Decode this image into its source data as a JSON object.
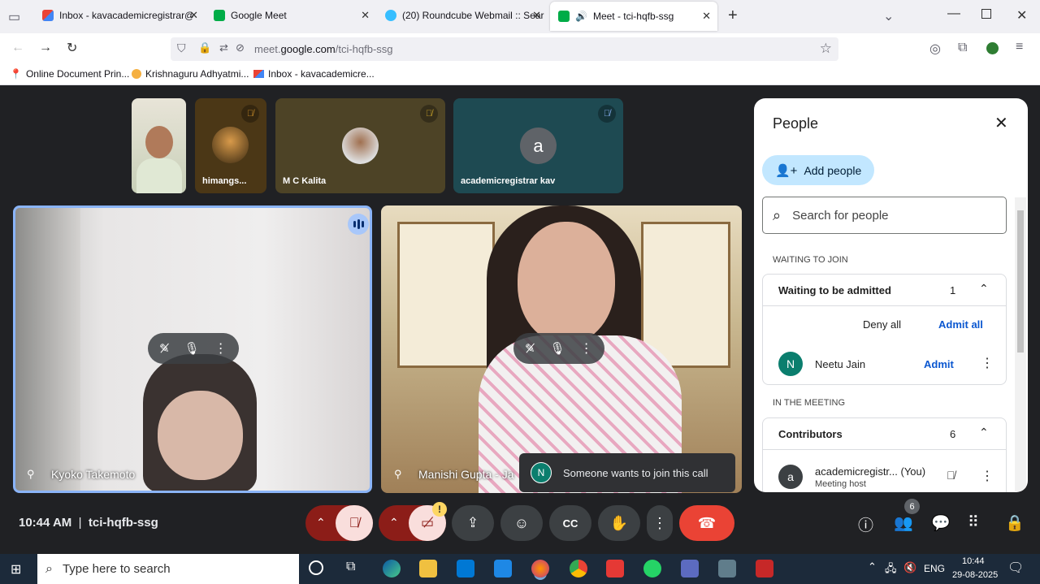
{
  "tabs": [
    {
      "title": "Inbox - kavacademicregistrar@",
      "favicon": "gmail-icon"
    },
    {
      "title": "Google Meet",
      "favicon": "meet-icon"
    },
    {
      "title": "(20) Roundcube Webmail :: Sear",
      "favicon": "roundcube-icon"
    },
    {
      "title": "Meet - tci-hqfb-ssg",
      "favicon": "meet-icon",
      "active": true
    }
  ],
  "url": {
    "prefix": "meet.",
    "domain": "google.com",
    "path": "/tci-hqfb-ssg"
  },
  "bookmarks": [
    {
      "label": "Online Document Prin..."
    },
    {
      "label": "Krishnaguru Adhyatmi..."
    },
    {
      "label": "Inbox - kavacademicre..."
    }
  ],
  "participants_top": [
    {
      "name": "",
      "muted": false
    },
    {
      "name": "himangs...",
      "muted": true
    },
    {
      "name": "M C Kalita",
      "muted": true
    },
    {
      "name": "academicregistrar kav",
      "avatar_letter": "a",
      "muted": true
    }
  ],
  "main_tiles": [
    {
      "name": "Kyoko Takemoto",
      "speaking": true
    },
    {
      "name": "Manishi Gupta - Ja"
    }
  ],
  "toast": {
    "avatar": "N",
    "text": "Someone wants to join this call"
  },
  "meeting": {
    "time": "10:44 AM",
    "separator": "|",
    "code": "tci-hqfb-ssg",
    "people_count": "6",
    "camera_warning": "!"
  },
  "people_panel": {
    "title": "People",
    "add_people": "Add people",
    "search_placeholder": "Search for people",
    "waiting_section": "WAITING TO JOIN",
    "waiting_header": "Waiting to be admitted",
    "waiting_count": "1",
    "deny_all": "Deny all",
    "admit_all": "Admit all",
    "waiting_person": {
      "initial": "N",
      "name": "Neetu Jain",
      "admit": "Admit"
    },
    "meeting_section": "IN THE MEETING",
    "contributors_header": "Contributors",
    "contributors_count": "6",
    "host": {
      "initial": "a",
      "name": "academicregistr...",
      "you": "(You)",
      "role": "Meeting host"
    }
  },
  "taskbar": {
    "search_placeholder": "Type here to search",
    "lang": "ENG",
    "time": "10:44",
    "date": "29-08-2025"
  },
  "colors": {
    "accent": "#0b57d0",
    "hangup": "#ea4335",
    "mute_red": "#8c1d18",
    "teal_avatar": "#0b7e6e"
  }
}
